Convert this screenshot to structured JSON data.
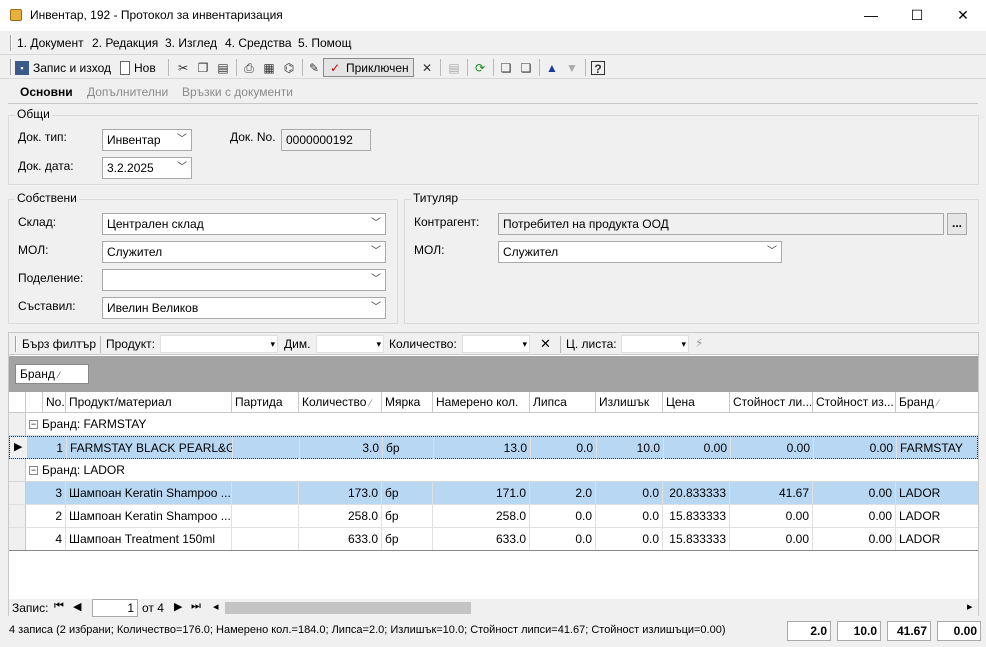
{
  "window": {
    "title": "Инвентар, 192 - Протокол за инвентаризация",
    "minimize": "—",
    "maximize": "☐",
    "close": "✕"
  },
  "menu": [
    "1. Документ",
    "2. Редакция",
    "3. Изглед",
    "4. Средства",
    "5. Помощ"
  ],
  "toolbar": {
    "save_exit": "Запис и изход",
    "new": "Нов",
    "complete": "Приключен"
  },
  "tabs": [
    "Основни",
    "Допълнителни",
    "Връзки с документи"
  ],
  "general": {
    "title": "Общи",
    "doc_type_label": "Док. тип:",
    "doc_type": "Инвентар",
    "doc_no_label": "Док. No.",
    "doc_no": "0000000192",
    "doc_date_label": "Док. дата:",
    "doc_date": "3.2.2025"
  },
  "own": {
    "title": "Собствени",
    "warehouse_label": "Склад:",
    "warehouse": "Централен склад",
    "mol_label": "МОЛ:",
    "mol": "Служител",
    "division_label": "Поделение:",
    "division": "",
    "author_label": "Съставил:",
    "author": "Ивелин Великов"
  },
  "holder": {
    "title": "Титуляр",
    "contractor_label": "Контрагент:",
    "contractor": "Потребител на продукта ООД",
    "mol_label": "МОЛ:",
    "mol": "Служител",
    "ellipsis": "..."
  },
  "filter": {
    "quick": "Бърз филтър",
    "product": "Продукт:",
    "dim": "Дим.",
    "qty": "Количество:",
    "price_list": "Ц. листа:"
  },
  "group_chip": "Бранд",
  "columns": [
    "No.",
    "Продукт/материал",
    "Партида",
    "Количество",
    "Мярка",
    "Намерено кол.",
    "Липса",
    "Излишък",
    "Цена",
    "Стойност ли...",
    "Стойност из...",
    "Бранд"
  ],
  "groups": [
    {
      "label": "Бранд: FARMSTAY",
      "rows": [
        {
          "no": "1",
          "product": "FARMSTAY BLACK PEARL&G...",
          "batch": "",
          "qty": "3.0",
          "unit": "бр",
          "found": "13.0",
          "missing": "0.0",
          "surplus": "10.0",
          "price": "0.00",
          "val_missing": "0.00",
          "val_surplus": "0.00",
          "brand": "FARMSTAY"
        }
      ]
    },
    {
      "label": "Бранд: LADOR",
      "rows": [
        {
          "no": "3",
          "product": "Шампоан Keratin Shampoo ...",
          "batch": "",
          "qty": "173.0",
          "unit": "бр",
          "found": "171.0",
          "missing": "2.0",
          "surplus": "0.0",
          "price": "20.833333",
          "val_missing": "41.67",
          "val_surplus": "0.00",
          "brand": "LADOR"
        },
        {
          "no": "2",
          "product": "Шампоан Keratin Shampoo ...",
          "batch": "",
          "qty": "258.0",
          "unit": "бр",
          "found": "258.0",
          "missing": "0.0",
          "surplus": "0.0",
          "price": "15.833333",
          "val_missing": "0.00",
          "val_surplus": "0.00",
          "brand": "LADOR"
        },
        {
          "no": "4",
          "product": "Шампоан Treatment 150ml",
          "batch": "",
          "qty": "633.0",
          "unit": "бр",
          "found": "633.0",
          "missing": "0.0",
          "surplus": "0.0",
          "price": "15.833333",
          "val_missing": "0.00",
          "val_surplus": "0.00",
          "brand": "LADOR"
        }
      ]
    }
  ],
  "nav": {
    "record_label": "Запис:",
    "record": "1",
    "of": "от 4"
  },
  "status": {
    "text": "4 записа (2 избрани; Количество=176.0; Намерено кол.=184.0; Липса=2.0; Излишък=10.0; Стойност липси=41.67; Стойност излишъци=0.00)",
    "totals": [
      "2.0",
      "10.0",
      "41.67",
      "0.00"
    ]
  }
}
